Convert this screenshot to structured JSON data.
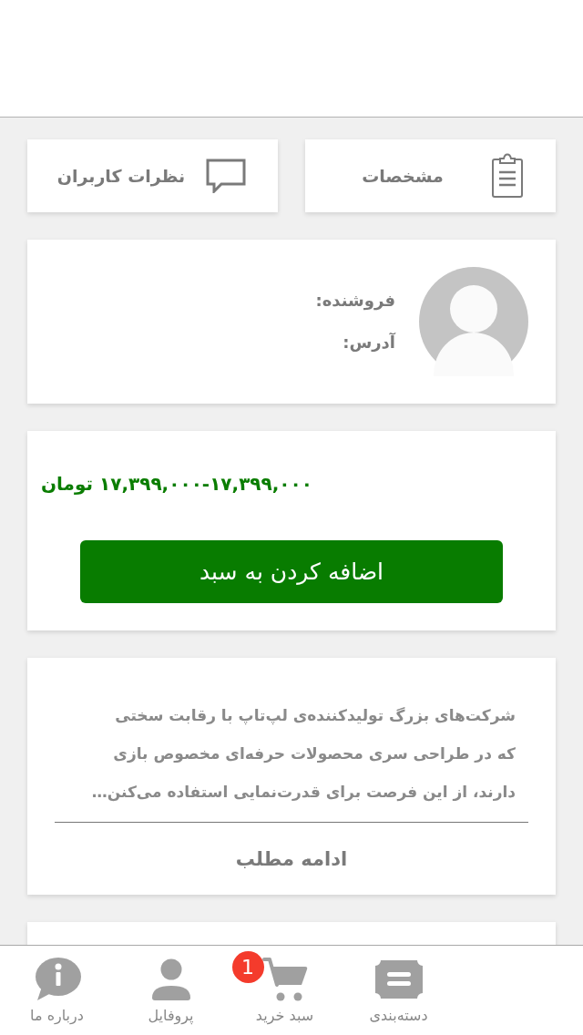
{
  "tabs": [
    {
      "kind": "clipboard",
      "label": "مشخصات"
    },
    {
      "kind": "comment",
      "label": "نظرات کاربران"
    }
  ],
  "seller": {
    "seller_label": "فروشنده:",
    "address_label": "آدرس:"
  },
  "price": {
    "text": "۱۷,۳۹۹,۰۰۰-۱۷,۳۹۹,۰۰۰ تومان",
    "button": "اضافه کردن به سبد"
  },
  "description": {
    "text": "شرکت‌های بزرگ تولیدکننده‌ی لپ‌تاپ با رقابت سختی\nکه در طراحی سری محصولات حرفه‌ای مخصوص بازی\nدارند، از این فرصت برای قدرت‌نمایی استفاده می‌کنن…",
    "more_link": "ادامه مطلب"
  },
  "bottom_nav": [
    {
      "kind": "category",
      "label": "دسته‌بندی"
    },
    {
      "kind": "cart",
      "label": "سبد خرید",
      "badge": "1"
    },
    {
      "kind": "profile",
      "label": "پروفایل"
    },
    {
      "kind": "info",
      "label": "درباره ما"
    }
  ]
}
